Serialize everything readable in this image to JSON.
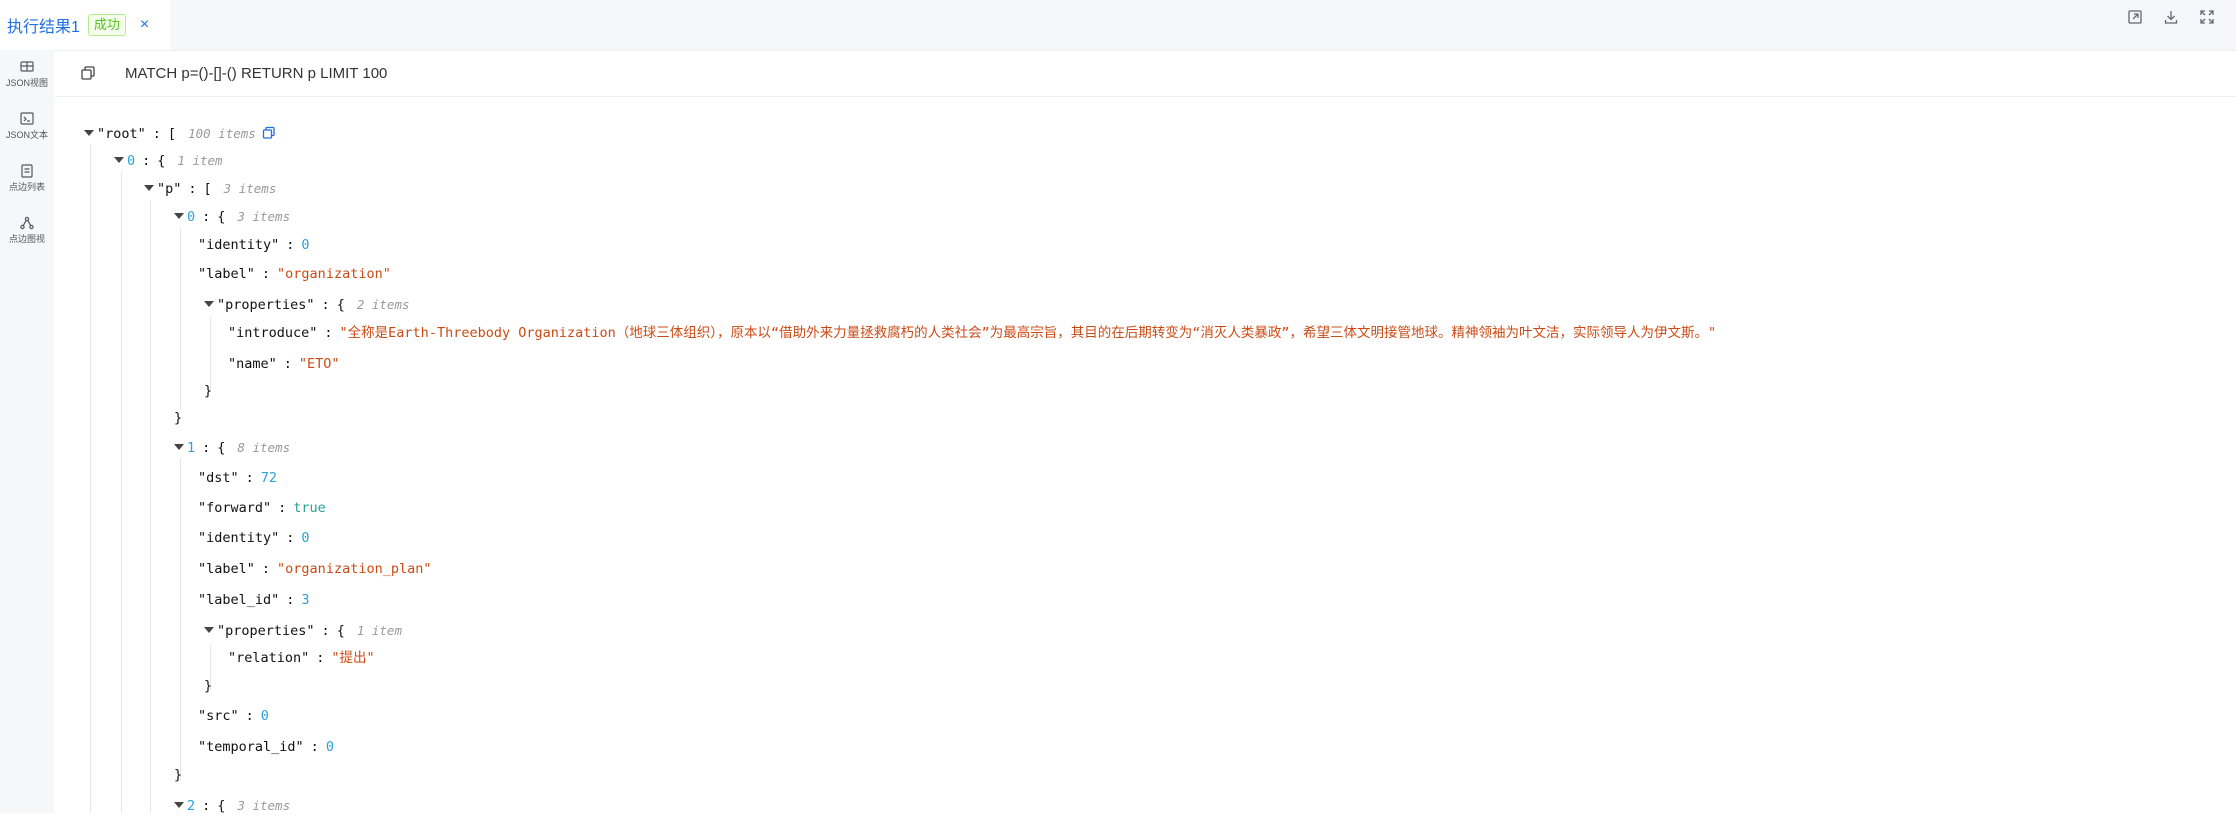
{
  "tab": {
    "title": "执行结果1",
    "status": "成功",
    "close": "×"
  },
  "top_actions": [
    "export-icon",
    "download-icon",
    "fullscreen-icon"
  ],
  "sidebar": [
    {
      "label": "JSON视图",
      "icon": "table-icon"
    },
    {
      "label": "JSON文本",
      "icon": "terminal-icon"
    },
    {
      "label": "点边列表",
      "icon": "list-icon"
    },
    {
      "label": "点边图视",
      "icon": "graph-icon"
    }
  ],
  "query": "MATCH p=()-[]-() RETURN p LIMIT 100",
  "json": {
    "root_key": "\"root\"",
    "root_count": "100 items",
    "i0": "0",
    "i0_count": "1 item",
    "p_key": "\"p\"",
    "p_count": "3 items",
    "n0": "0",
    "n0_count": "3 items",
    "identity_key": "\"identity\"",
    "n0_identity": "0",
    "label_key": "\"label\"",
    "n0_label": "\"organization\"",
    "properties_key": "\"properties\"",
    "n0_props_count": "2 items",
    "introduce_key": "\"introduce\"",
    "introduce_val": "\"全称是Earth-Threebody Organization（地球三体组织），原本以“借助外来力量拯救腐朽的人类社会”为最高宗旨，其目的在后期转变为“消灭人类暴政”，希望三体文明接管地球。精神领袖为叶文洁，实际领导人为伊文斯。\"",
    "name_key": "\"name\"",
    "name_val": "\"ETO\"",
    "n1": "1",
    "n1_count": "8 items",
    "dst_key": "\"dst\"",
    "dst_val": "72",
    "forward_key": "\"forward\"",
    "forward_val": "true",
    "n1_identity": "0",
    "n1_label": "\"organization_plan\"",
    "label_id_key": "\"label_id\"",
    "label_id_val": "3",
    "n1_props_count": "1 item",
    "relation_key": "\"relation\"",
    "relation_val": "\"提出\"",
    "src_key": "\"src\"",
    "src_val": "0",
    "temporal_id_key": "\"temporal_id\"",
    "temporal_id_val": "0",
    "n2": "2",
    "n2_count": "3 items"
  }
}
